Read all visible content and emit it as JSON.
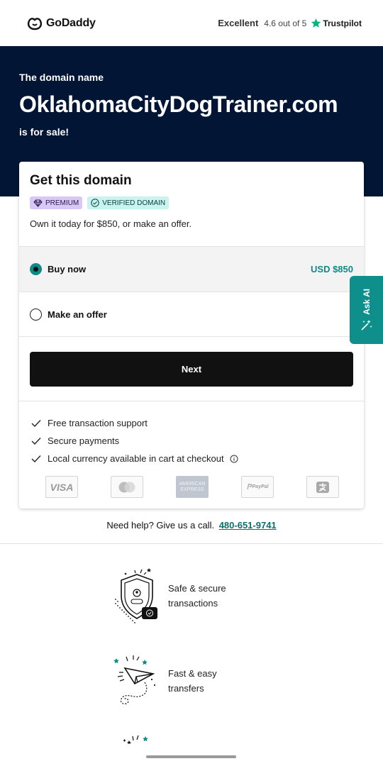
{
  "header": {
    "logo_text": "GoDaddy",
    "rating_label": "Excellent",
    "rating_score": "4.6 out of 5",
    "rating_provider": "Trustpilot"
  },
  "hero": {
    "intro": "The domain name",
    "domain": "OklahomaCityDogTrainer.com",
    "suffix": "is for sale!"
  },
  "card": {
    "title": "Get this domain",
    "badges": {
      "premium": "PREMIUM",
      "verified": "VERIFIED DOMAIN"
    },
    "offer_text": "Own it today for $850, or make an offer.",
    "options": [
      {
        "label": "Buy now",
        "price": "USD $850",
        "selected": true
      },
      {
        "label": "Make an offer",
        "selected": false
      }
    ],
    "next_label": "Next",
    "features": [
      "Free transaction support",
      "Secure payments",
      "Local currency available in cart at checkout"
    ],
    "payments": [
      "VISA",
      "Mastercard",
      "AMERICAN EXPRESS",
      "PayPal",
      "Alipay"
    ],
    "payment_labels": {
      "visa": "VISA",
      "amex_1": "AMERICAN",
      "amex_2": "EXPRESS",
      "paypal": "PayPal"
    }
  },
  "help": {
    "text": "Need help? Give us a call.",
    "phone": "480-651-9741"
  },
  "perks": [
    {
      "text": "Safe & secure transactions"
    },
    {
      "text": "Fast & easy transfers"
    }
  ],
  "ask_ai": {
    "label": "Ask AI"
  },
  "colors": {
    "hero_bg": "#021534",
    "accent_teal": "#0e8a87",
    "premium_badge": "#d7c8f5",
    "verified_badge": "#c9f3ef",
    "trustpilot_star": "#00b67a"
  }
}
